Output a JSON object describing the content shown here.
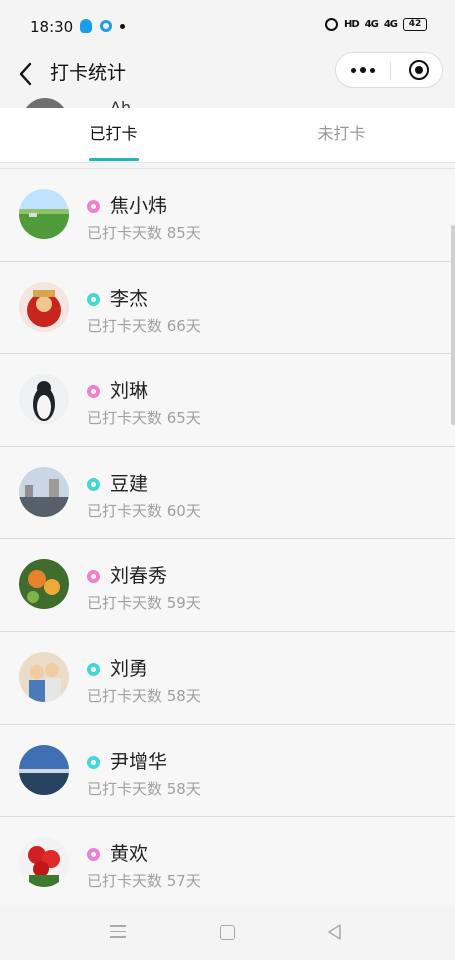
{
  "status_bar": {
    "time": "18:30",
    "hd": "HD",
    "signal_1": "4G",
    "signal_2": "4G",
    "battery": "42"
  },
  "header": {
    "title": "打卡统计"
  },
  "peek_row": {
    "name_fragment": "Ah"
  },
  "tabs": [
    {
      "label": "已打卡",
      "active": true
    },
    {
      "label": "未打卡",
      "active": false
    }
  ],
  "accent_color": "#1fb6b4",
  "members": [
    {
      "name": "焦小炜",
      "gender": "female",
      "days": "已打卡天数 85天",
      "avatar": "grassland"
    },
    {
      "name": "李杰",
      "gender": "male",
      "days": "已打卡天数 66天",
      "avatar": "red-mascot"
    },
    {
      "name": "刘琳",
      "gender": "female",
      "days": "已打卡天数 65天",
      "avatar": "penguin"
    },
    {
      "name": "豆建",
      "gender": "male",
      "days": "已打卡天数 60天",
      "avatar": "city-river"
    },
    {
      "name": "刘春秀",
      "gender": "female",
      "days": "已打卡天数 59天",
      "avatar": "parrots"
    },
    {
      "name": "刘勇",
      "gender": "male",
      "days": "已打卡天数 58天",
      "avatar": "children"
    },
    {
      "name": "尹增华",
      "gender": "male",
      "days": "已打卡天数 58天",
      "avatar": "lake-sky"
    },
    {
      "name": "黄欢",
      "gender": "female",
      "days": "已打卡天数 57天",
      "avatar": "red-roses"
    }
  ]
}
